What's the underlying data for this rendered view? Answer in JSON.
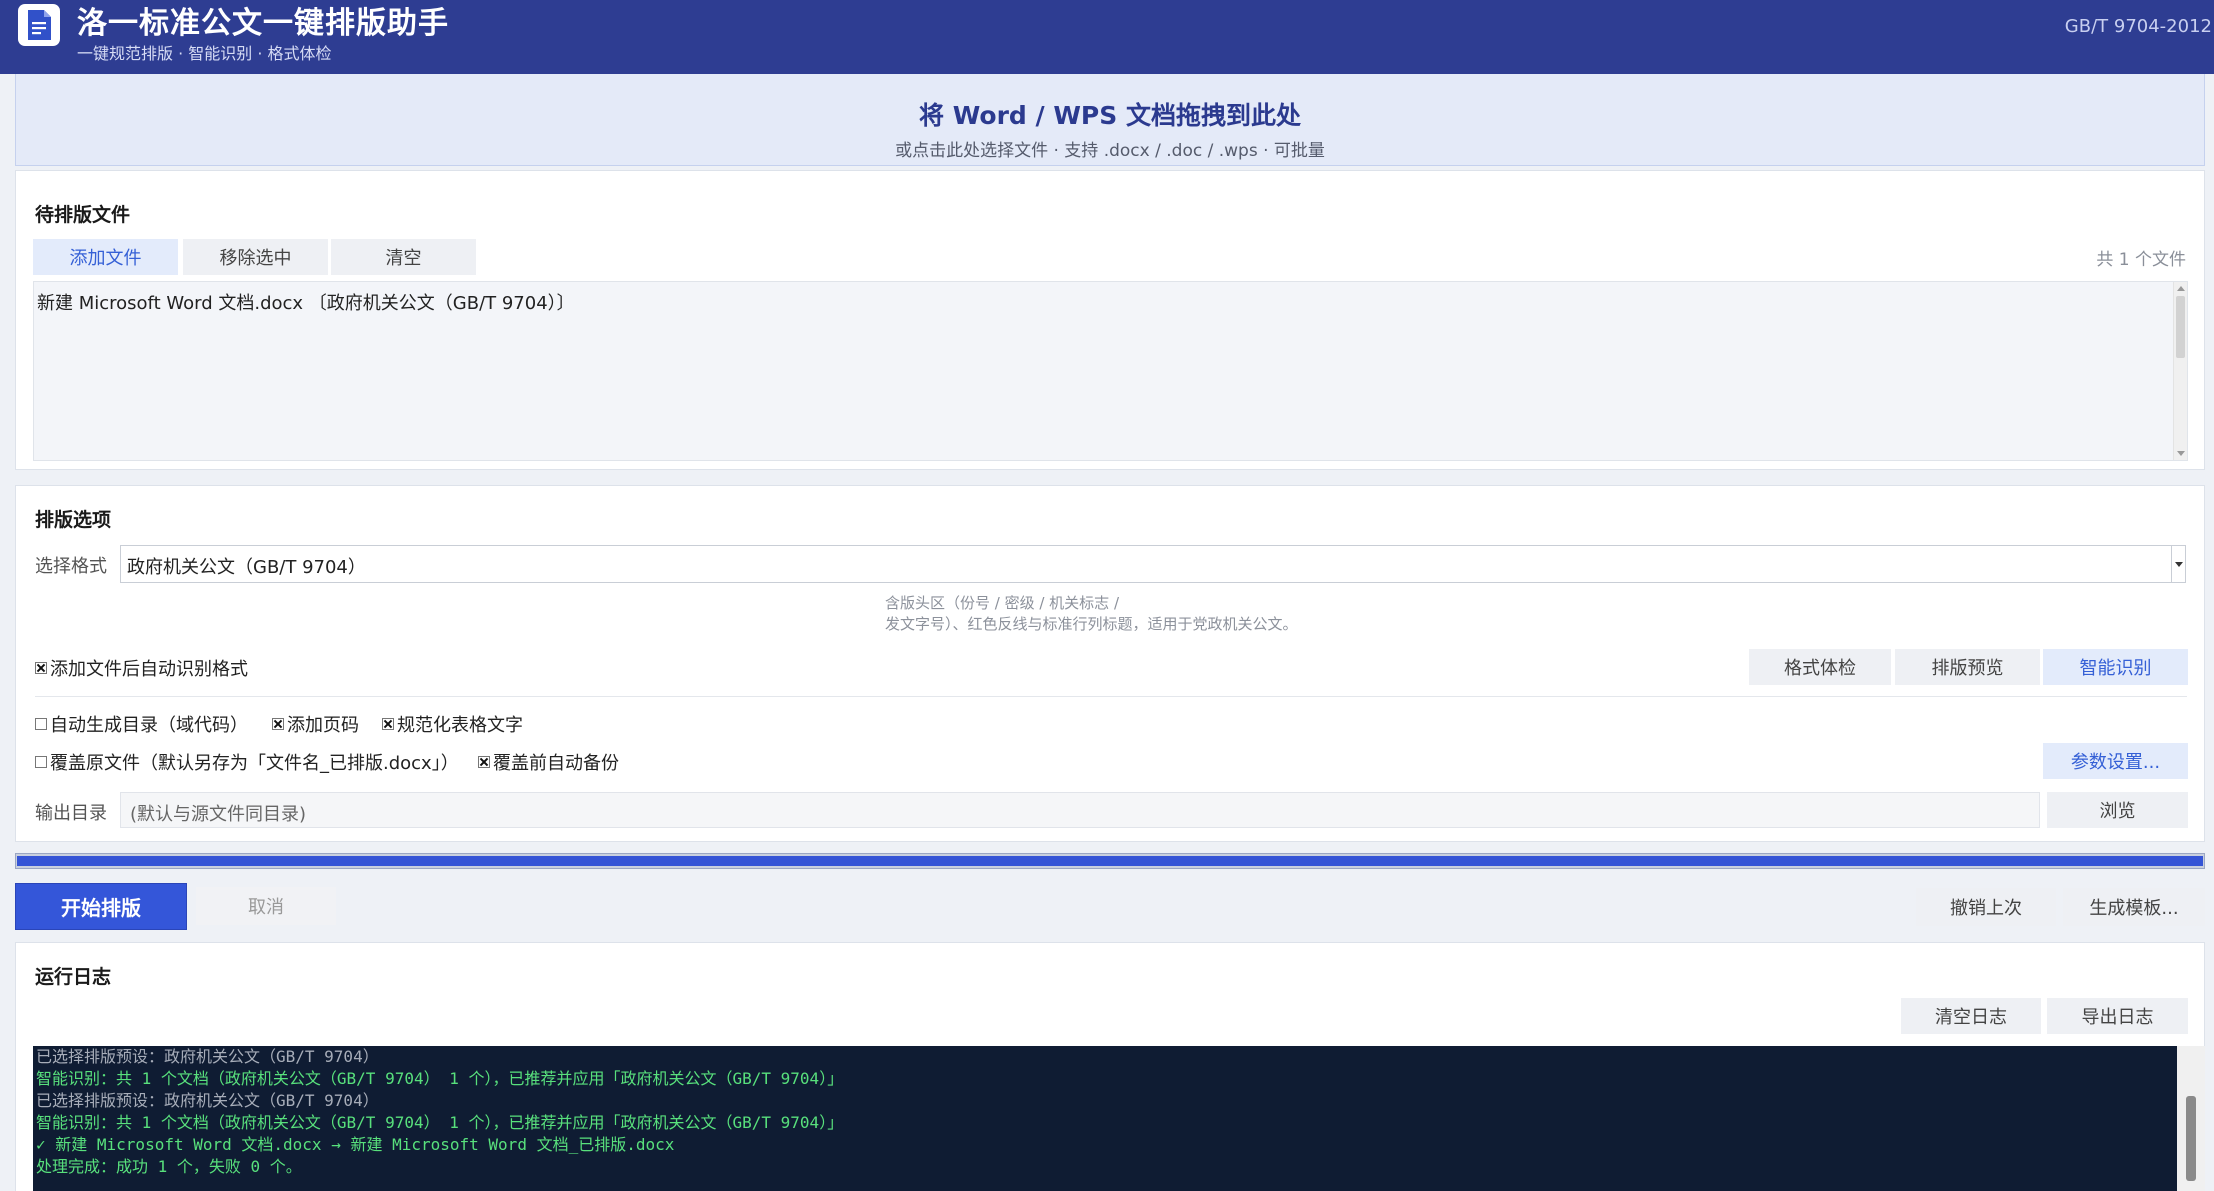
{
  "header": {
    "title": "洛一标准公文一键排版助手",
    "subtitle": "一键规范排版 · 智能识别 · 格式体检",
    "standard": "GB/T 9704-2012",
    "logo_icon": "document-icon"
  },
  "dropzone": {
    "title": "将 Word / WPS 文档拖拽到此处",
    "hint": "或点击此处选择文件 · 支持 .docx / .doc / .wps · 可批量"
  },
  "files": {
    "section_title": "待排版文件",
    "buttons": {
      "add": "添加文件",
      "remove_selected": "移除选中",
      "clear": "清空"
    },
    "count": "共 1 个文件",
    "items": [
      "新建 Microsoft Word 文档.docx  〔政府机关公文（GB/T 9704）〕"
    ]
  },
  "options": {
    "section_title": "排版选项",
    "format_label": "选择格式",
    "format_value": "政府机关公文（GB/T 9704）",
    "format_desc_line1": "含版头区（份号 / 密级 / 机关标志 /",
    "format_desc_line2": "发文字号）、红色反线与标准行列标题，适用于党政机关公文。",
    "auto_detect": {
      "label": "添加文件后自动识别格式",
      "checked": true
    },
    "action_buttons": {
      "check": "格式体检",
      "preview": "排版预览",
      "smart": "智能识别"
    },
    "toc": {
      "label": "自动生成目录（域代码）",
      "checked": false
    },
    "page_num": {
      "label": "添加页码",
      "checked": true
    },
    "table_text": {
      "label": "规范化表格文字",
      "checked": true
    },
    "overwrite": {
      "label": "覆盖原文件（默认另存为「文件名_已排版.docx」）",
      "checked": false
    },
    "backup": {
      "label": "覆盖前自动备份",
      "checked": true
    },
    "params_button": "参数设置...",
    "output_label": "输出目录",
    "output_placeholder": "(默认与源文件同目录)",
    "browse_button": "浏览"
  },
  "progress": {
    "value": 1.0,
    "color": "#3454d6"
  },
  "actions": {
    "start": "开始排版",
    "cancel": "取消",
    "undo": "撤销上次",
    "template": "生成模板..."
  },
  "log": {
    "section_title": "运行日志",
    "clear_button": "清空日志",
    "export_button": "导出日志",
    "lines": [
      {
        "text": "已选择排版预设：政府机关公文（GB/T 9704）",
        "style": "gray"
      },
      {
        "text": "智能识别：共 1 个文档（政府机关公文（GB/T 9704） 1 个），已推荐并应用「政府机关公文（GB/T 9704）」",
        "style": "green"
      },
      {
        "text": "已选择排版预设：政府机关公文（GB/T 9704）",
        "style": "gray"
      },
      {
        "text": "智能识别：共 1 个文档（政府机关公文（GB/T 9704） 1 个），已推荐并应用「政府机关公文（GB/T 9704）」",
        "style": "green"
      },
      {
        "text": "✓ 新建 Microsoft Word 文档.docx → 新建 Microsoft Word 文档_已排版.docx",
        "style": "green"
      },
      {
        "text": "处理完成：成功 1 个，失败 0 个。",
        "style": "green"
      }
    ]
  },
  "colors": {
    "header_bg": "#2e3d92",
    "accent": "#3456d9",
    "console_bg": "#0f1c33",
    "log_green": "#58e07c"
  }
}
